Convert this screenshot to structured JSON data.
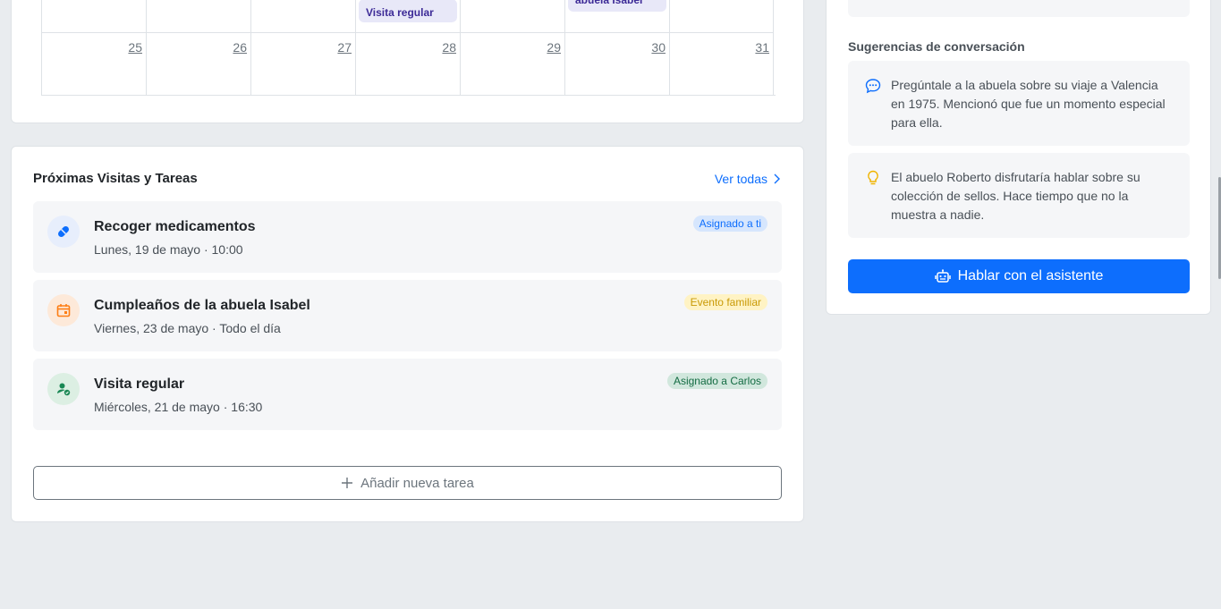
{
  "calendar": {
    "prev_row_events": [
      {
        "col": 3,
        "text": "Visita regular"
      },
      {
        "col": 5,
        "text": "abuela Isabel"
      }
    ],
    "last_week_days": [
      "25",
      "26",
      "27",
      "28",
      "29",
      "30",
      "31"
    ]
  },
  "tasks": {
    "title": "Próximas Visitas y Tareas",
    "see_all": "Ver todas",
    "items": [
      {
        "title": "Recoger medicamentos",
        "subtitle": "Lunes, 19 de mayo · 10:00",
        "badge": "Asignado a ti",
        "icon": "pill-icon",
        "icon_bg": "#e7eefc",
        "icon_color": "#0d6efd",
        "badge_bg": "#d6e6fd",
        "badge_color": "#0d6efd"
      },
      {
        "title": "Cumpleaños de la abuela Isabel",
        "subtitle": "Viernes, 23 de mayo · Todo el día",
        "badge": "Evento familiar",
        "icon": "calendar-event-icon",
        "icon_bg": "#fde9d9",
        "icon_color": "#fd7e14",
        "badge_bg": "#fff3c4",
        "badge_color": "#c99a06"
      },
      {
        "title": "Visita regular",
        "subtitle": "Miércoles, 21 de mayo · 16:30",
        "badge": "Asignado a Carlos",
        "icon": "person-check-icon",
        "icon_bg": "#dcefe3",
        "icon_color": "#198754",
        "badge_bg": "#d1e7dd",
        "badge_color": "#146c43"
      }
    ],
    "add_label": "Añadir nueva tarea"
  },
  "assistant": {
    "suggestions_title": "Sugerencias de conversación",
    "suggestions": [
      {
        "icon": "chat-dots-icon",
        "text": "Pregúntale a la abuela sobre su viaje a Valencia en 1975. Mencionó que fue un momento especial para ella."
      },
      {
        "icon": "lightbulb-icon",
        "text": "El abuelo Roberto disfrutaría hablar sobre su colección de sellos. Hace tiempo que no la muestra a nadie."
      }
    ],
    "button_label": "Hablar con el asistente"
  },
  "colors": {
    "primary": "#0d6efd",
    "event_purple": "#3d2b97",
    "page_bg": "#e9ecef"
  }
}
